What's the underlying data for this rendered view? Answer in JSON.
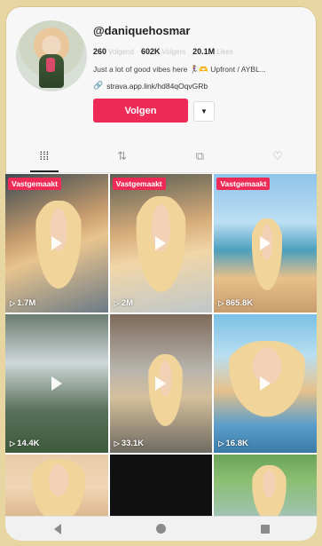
{
  "profile": {
    "username": "@daniquehosmar",
    "stats": [
      {
        "value": "260",
        "label": "Volgend"
      },
      {
        "value": "602K",
        "label": "Volgers"
      },
      {
        "value": "20.1M",
        "label": "Likes"
      }
    ],
    "bio": "Just a lot of good vibes here 🏃‍♀️🫶 Upfront / AYBL...",
    "link": "strava.app.link/hd84qOqvGRb",
    "follow_label": "Volgen",
    "more_label": "▼"
  },
  "tabs": [
    {
      "name": "videos",
      "icon": "grid-icon",
      "glyph": "⁞⁞⁞",
      "active": true
    },
    {
      "name": "reposts",
      "icon": "repost-icon",
      "glyph": "⇅",
      "active": false
    },
    {
      "name": "favorites",
      "icon": "bookmark-icon",
      "glyph": "⧉",
      "active": false
    },
    {
      "name": "liked",
      "icon": "liked-icon",
      "glyph": "♡",
      "active": false
    }
  ],
  "videos": [
    {
      "pinned": "Vastgemaakt",
      "views": "1.7M"
    },
    {
      "pinned": "Vastgemaakt",
      "views": "2M"
    },
    {
      "pinned": "Vastgemaakt",
      "views": "865.8K"
    },
    {
      "pinned": "",
      "views": "14.4K"
    },
    {
      "pinned": "",
      "views": "33.1K"
    },
    {
      "pinned": "",
      "views": "16.8K"
    },
    {
      "pinned": "",
      "views": ""
    },
    {
      "pinned": "",
      "views": ""
    },
    {
      "pinned": "",
      "views": ""
    }
  ],
  "colors": {
    "accent": "#ee2b57"
  }
}
